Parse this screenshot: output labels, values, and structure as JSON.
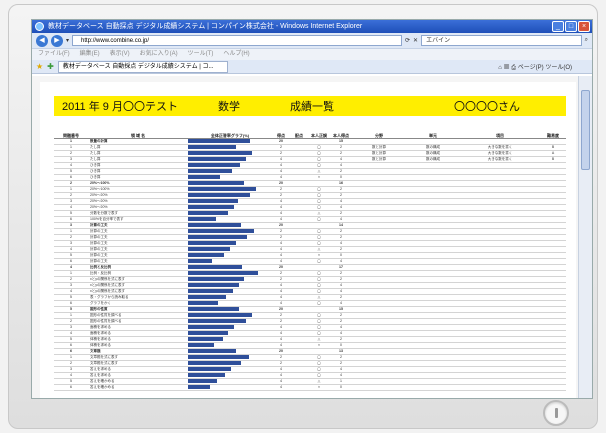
{
  "window": {
    "title": "教材データベース 自動採点 デジタル成績システム | コンパイン株式会社 - Windows Internet Explorer"
  },
  "address": {
    "url": "http://www.combine.co.jp/",
    "search_value": "エバイン"
  },
  "menu": [
    "ファイル(F)",
    "編集(E)",
    "表示(V)",
    "お気に入り(A)",
    "ツール(T)",
    "ヘルプ(H)"
  ],
  "tab": {
    "label": "教材データベース 自動採点 デジタル成績システム | コ..."
  },
  "toolbar": {
    "page_label": "ページ(P)",
    "tools_label": "ツール(O)"
  },
  "report": {
    "date": "2011 年 9 月〇〇テスト",
    "subject": "数学",
    "title": "成績一覧",
    "student": "〇〇〇〇さん"
  },
  "table": {
    "headers": [
      "問題番号",
      "領 域 名",
      "全体正答率グラフ(%)",
      "得点",
      "配点",
      "本人正誤",
      "本人得点",
      "分野",
      "単元",
      "項目",
      "難易度"
    ],
    "rows": [
      {
        "num": "1",
        "name": "数量の計算",
        "pct": 78,
        "score": "20",
        "pts": "",
        "mark": "",
        "self": "15",
        "section": true
      },
      {
        "num": "1",
        "name": "たし算",
        "pct": 60,
        "score": "2",
        "pts": "",
        "mark": "◯",
        "self": "2",
        "a": "数と計算",
        "b": "数の構成",
        "c": "大きな数を書く",
        "d": "B"
      },
      {
        "num": "2",
        "name": "たし算",
        "pct": 80,
        "score": "2",
        "pts": "",
        "mark": "◯",
        "self": "2",
        "a": "数と計算",
        "b": "数の構成",
        "c": "大きな数を書く",
        "d": "A"
      },
      {
        "num": "3",
        "name": "たし算",
        "pct": 72,
        "score": "4",
        "pts": "",
        "mark": "◯",
        "self": "4",
        "a": "数と計算",
        "b": "数の構成",
        "c": "大きな数を書く",
        "d": "B"
      },
      {
        "num": "4",
        "name": "ひき算",
        "pct": 65,
        "score": "4",
        "pts": "",
        "mark": "◯",
        "self": "4"
      },
      {
        "num": "5",
        "name": "ひき算",
        "pct": 55,
        "score": "4",
        "pts": "",
        "mark": "△",
        "self": "2"
      },
      {
        "num": "6",
        "name": "ひき算",
        "pct": 40,
        "score": "4",
        "pts": "",
        "mark": "×",
        "self": "0"
      },
      {
        "num": "2",
        "name": "20%～100%",
        "pct": 70,
        "score": "20",
        "pts": "",
        "mark": "",
        "self": "16",
        "section": true
      },
      {
        "num": "1",
        "name": "20%～100%",
        "pct": 85,
        "score": "2",
        "pts": "",
        "mark": "◯",
        "self": "2"
      },
      {
        "num": "2",
        "name": "20%～20%",
        "pct": 78,
        "score": "2",
        "pts": "",
        "mark": "◯",
        "self": "2"
      },
      {
        "num": "3",
        "name": "20%～20%",
        "pct": 62,
        "score": "4",
        "pts": "",
        "mark": "◯",
        "self": "4"
      },
      {
        "num": "4",
        "name": "20%～20%",
        "pct": 58,
        "score": "4",
        "pts": "",
        "mark": "◯",
        "self": "4"
      },
      {
        "num": "5",
        "name": "分数を分数で表す",
        "pct": 50,
        "score": "4",
        "pts": "",
        "mark": "△",
        "self": "2"
      },
      {
        "num": "6",
        "name": "100%を百分率で表す",
        "pct": 35,
        "score": "4",
        "pts": "",
        "mark": "◯",
        "self": "4"
      },
      {
        "num": "3",
        "name": "計算の工夫",
        "pct": 66,
        "score": "20",
        "pts": "",
        "mark": "",
        "self": "14",
        "section": true
      },
      {
        "num": "1",
        "name": "計算の工夫",
        "pct": 82,
        "score": "2",
        "pts": "",
        "mark": "◯",
        "self": "2"
      },
      {
        "num": "2",
        "name": "計算の工夫",
        "pct": 74,
        "score": "2",
        "pts": "",
        "mark": "◯",
        "self": "2"
      },
      {
        "num": "3",
        "name": "計算の工夫",
        "pct": 60,
        "score": "4",
        "pts": "",
        "mark": "◯",
        "self": "4"
      },
      {
        "num": "4",
        "name": "計算の工夫",
        "pct": 52,
        "score": "4",
        "pts": "",
        "mark": "△",
        "self": "2"
      },
      {
        "num": "5",
        "name": "計算の工夫",
        "pct": 45,
        "score": "4",
        "pts": "",
        "mark": "×",
        "self": "0"
      },
      {
        "num": "6",
        "name": "計算の工夫",
        "pct": 30,
        "score": "4",
        "pts": "",
        "mark": "◯",
        "self": "4"
      },
      {
        "num": "4",
        "name": "比例と反比例",
        "pct": 68,
        "score": "20",
        "pts": "",
        "mark": "",
        "self": "17",
        "section": true
      },
      {
        "num": "1",
        "name": "比例・反比例",
        "pct": 88,
        "score": "2",
        "pts": "",
        "mark": "◯",
        "self": "2"
      },
      {
        "num": "2",
        "name": "xとyの関係を式に表す",
        "pct": 70,
        "score": "2",
        "pts": "",
        "mark": "◯",
        "self": "2"
      },
      {
        "num": "3",
        "name": "xとyの関係を式に表す",
        "pct": 64,
        "score": "4",
        "pts": "",
        "mark": "◯",
        "self": "4"
      },
      {
        "num": "4",
        "name": "xとyの関係を式に表す",
        "pct": 56,
        "score": "4",
        "pts": "",
        "mark": "◯",
        "self": "4"
      },
      {
        "num": "5",
        "name": "表・グラフから読み取る",
        "pct": 48,
        "score": "4",
        "pts": "",
        "mark": "△",
        "self": "2"
      },
      {
        "num": "6",
        "name": "グラフをかく",
        "pct": 38,
        "score": "4",
        "pts": "",
        "mark": "◯",
        "self": "4"
      },
      {
        "num": "5",
        "name": "図形の性質",
        "pct": 64,
        "score": "20",
        "pts": "",
        "mark": "",
        "self": "15",
        "section": true
      },
      {
        "num": "1",
        "name": "図形の性質を調べる",
        "pct": 80,
        "score": "2",
        "pts": "",
        "mark": "◯",
        "self": "2"
      },
      {
        "num": "2",
        "name": "図形の性質を調べる",
        "pct": 72,
        "score": "2",
        "pts": "",
        "mark": "◯",
        "self": "2"
      },
      {
        "num": "3",
        "name": "面積を求める",
        "pct": 58,
        "score": "4",
        "pts": "",
        "mark": "◯",
        "self": "4"
      },
      {
        "num": "4",
        "name": "面積を求める",
        "pct": 50,
        "score": "4",
        "pts": "",
        "mark": "◯",
        "self": "4"
      },
      {
        "num": "5",
        "name": "体積を求める",
        "pct": 44,
        "score": "4",
        "pts": "",
        "mark": "△",
        "self": "2"
      },
      {
        "num": "6",
        "name": "体積を求める",
        "pct": 33,
        "score": "4",
        "pts": "",
        "mark": "×",
        "self": "0"
      },
      {
        "num": "6",
        "name": "文章題",
        "pct": 60,
        "score": "20",
        "pts": "",
        "mark": "",
        "self": "13",
        "section": true
      },
      {
        "num": "1",
        "name": "文章題を式に表す",
        "pct": 76,
        "score": "2",
        "pts": "",
        "mark": "◯",
        "self": "2"
      },
      {
        "num": "2",
        "name": "文章題を式に表す",
        "pct": 66,
        "score": "2",
        "pts": "",
        "mark": "◯",
        "self": "2"
      },
      {
        "num": "3",
        "name": "答えを求める",
        "pct": 54,
        "score": "4",
        "pts": "",
        "mark": "◯",
        "self": "4"
      },
      {
        "num": "4",
        "name": "答えを求める",
        "pct": 46,
        "score": "4",
        "pts": "",
        "mark": "◯",
        "self": "4"
      },
      {
        "num": "5",
        "name": "答えを確かめる",
        "pct": 36,
        "score": "4",
        "pts": "",
        "mark": "△",
        "self": "1"
      },
      {
        "num": "6",
        "name": "答えを確かめる",
        "pct": 28,
        "score": "4",
        "pts": "",
        "mark": "×",
        "self": "0"
      }
    ]
  },
  "colors": {
    "banner": "#ffee00",
    "bar": "#2f4f9a",
    "titlebar": "#1e4fb8"
  }
}
